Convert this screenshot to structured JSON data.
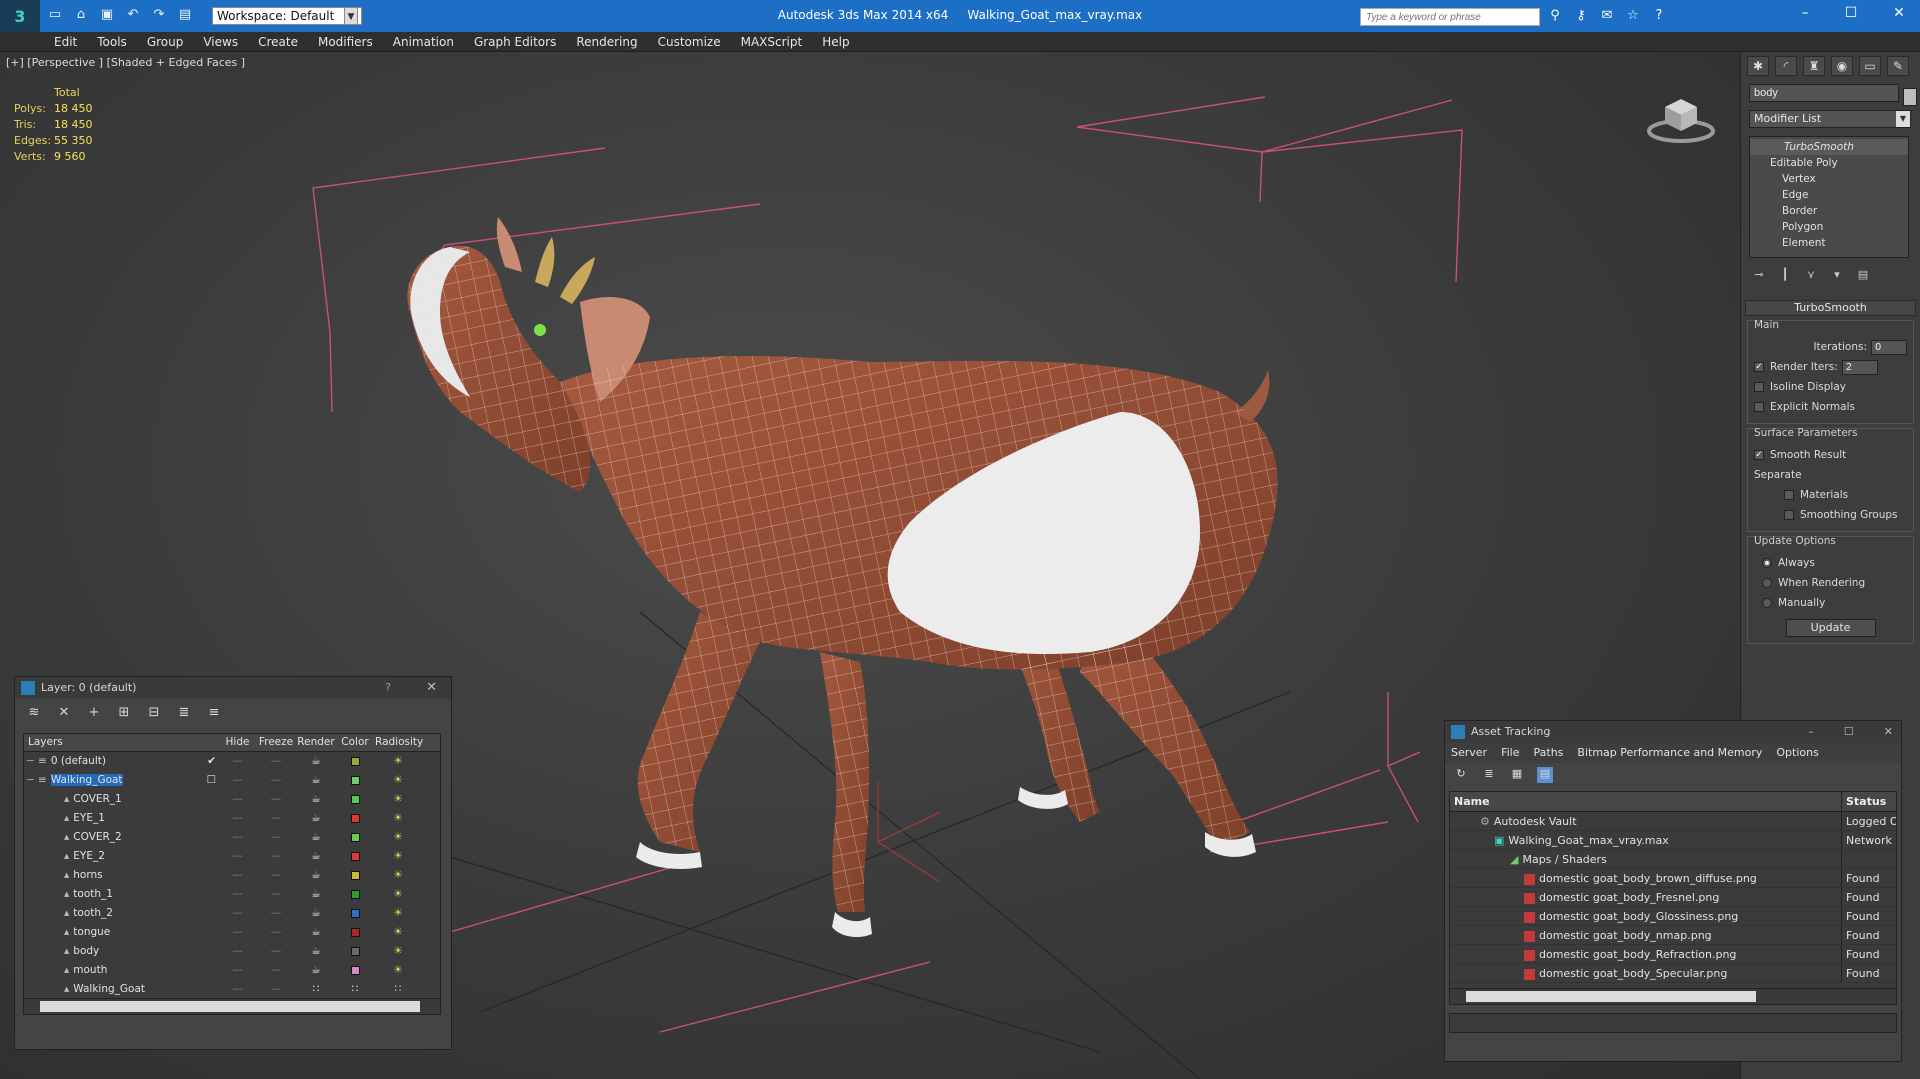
{
  "titlebar": {
    "app_title": "Autodesk 3ds Max  2014 x64",
    "file_name": "Walking_Goat_max_vray.max",
    "workspace": "Workspace: Default",
    "search_placeholder": "Type a keyword or phrase"
  },
  "menu": [
    "Edit",
    "Tools",
    "Group",
    "Views",
    "Create",
    "Modifiers",
    "Animation",
    "Graph Editors",
    "Rendering",
    "Customize",
    "MAXScript",
    "Help"
  ],
  "viewport": {
    "label": "[+] [Perspective ] [Shaded + Edged Faces ]",
    "stats_header": "Total",
    "stats": [
      {
        "key": "Polys:",
        "value": "18 450"
      },
      {
        "key": "Tris:",
        "value": "18 450"
      },
      {
        "key": "Edges:",
        "value": "55 350"
      },
      {
        "key": "Verts:",
        "value": "9 560"
      }
    ]
  },
  "command_panel": {
    "object_name": "body",
    "modifier_list": "Modifier List",
    "stack": {
      "top": "TurboSmooth",
      "base": "Editable Poly",
      "subs": [
        "Vertex",
        "Edge",
        "Border",
        "Polygon",
        "Element"
      ]
    },
    "rollout_title": "TurboSmooth",
    "main_group": "Main",
    "iterations_label": "Iterations:",
    "iterations_value": "0",
    "render_iters_label": "Render Iters:",
    "render_iters_value": "2",
    "isoline_display": "Isoline Display",
    "explicit_normals": "Explicit Normals",
    "surface_group": "Surface Parameters",
    "smooth_result": "Smooth Result",
    "separate_label": "Separate",
    "materials": "Materials",
    "smoothing_groups": "Smoothing Groups",
    "update_group": "Update Options",
    "always": "Always",
    "when_rendering": "When Rendering",
    "manually": "Manually",
    "update_button": "Update"
  },
  "layer_window": {
    "title": "Layer: 0 (default)",
    "help": "?",
    "columns": {
      "layers": "Layers",
      "hide": "Hide",
      "freeze": "Freeze",
      "render": "Render",
      "color": "Color",
      "radiosity": "Radiosity"
    },
    "rows": [
      {
        "name": "0 (default)",
        "color": "#9aa73a"
      },
      {
        "name": "Walking_Goat",
        "color": "#6ccf6c"
      },
      {
        "name": "COVER_1",
        "color": "#58c858"
      },
      {
        "name": "EYE_1",
        "color": "#d83a3a"
      },
      {
        "name": "COVER_2",
        "color": "#6cc84e"
      },
      {
        "name": "EYE_2",
        "color": "#d83a3a"
      },
      {
        "name": "horns",
        "color": "#c9b63a"
      },
      {
        "name": "tooth_1",
        "color": "#2f9a3a"
      },
      {
        "name": "tooth_2",
        "color": "#2f6fc8"
      },
      {
        "name": "tongue",
        "color": "#a82828"
      },
      {
        "name": "body",
        "color": "#6a6a6a"
      },
      {
        "name": "mouth",
        "color": "#d88ac8"
      },
      {
        "name": "Walking_Goat",
        "color": ""
      }
    ]
  },
  "asset_window": {
    "title": "Asset Tracking",
    "menu": [
      "Server",
      "File",
      "Paths",
      "Bitmap Performance and Memory",
      "Options"
    ],
    "columns": {
      "name": "Name",
      "status": "Status"
    },
    "rows": [
      {
        "name": "Autodesk Vault",
        "status": "Logged Out"
      },
      {
        "name": "Walking_Goat_max_vray.max",
        "status": "Network Path"
      },
      {
        "name": "Maps / Shaders",
        "status": ""
      },
      {
        "name": "domestic goat_body_brown_diffuse.png",
        "status": "Found"
      },
      {
        "name": "domestic goat_body_Fresnel.png",
        "status": "Found"
      },
      {
        "name": "domestic goat_body_Glossiness.png",
        "status": "Found"
      },
      {
        "name": "domestic goat_body_nmap.png",
        "status": "Found"
      },
      {
        "name": "domestic goat_body_Refraction.png",
        "status": "Found"
      },
      {
        "name": "domestic goat_body_Specular.png",
        "status": "Found"
      }
    ]
  },
  "colors": {
    "titlebar": "#1c6fc4",
    "selection": "#2369bc",
    "stats": "#f5e45a"
  }
}
